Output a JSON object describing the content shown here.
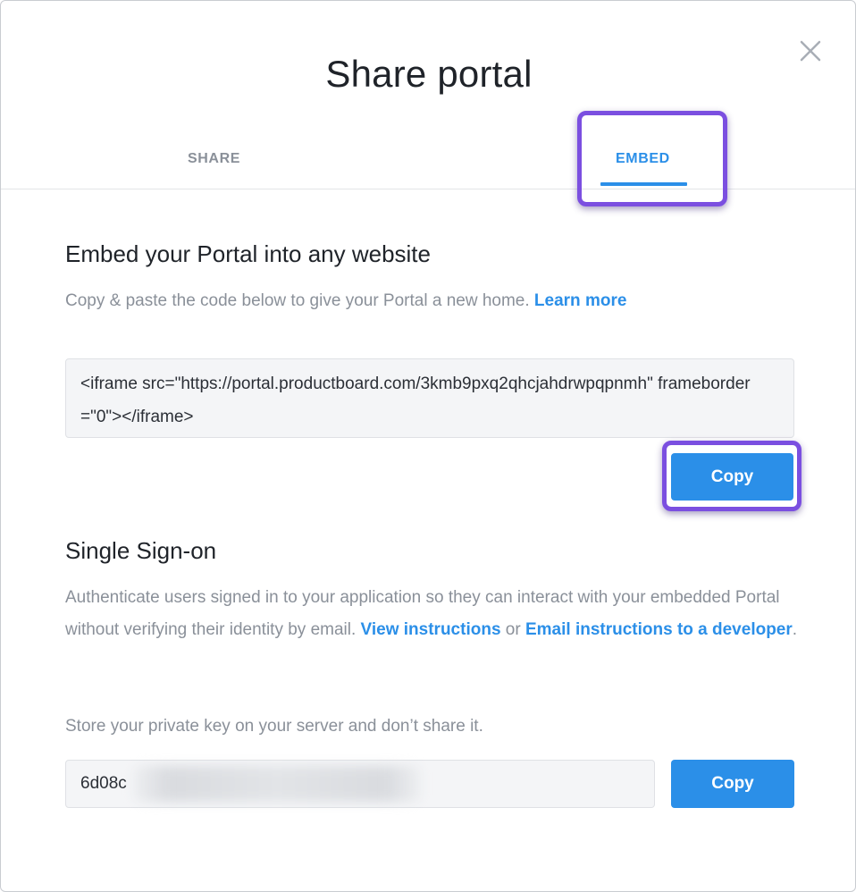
{
  "modal": {
    "title": "Share portal",
    "close_icon": "close-icon"
  },
  "tabs": [
    {
      "label": "SHARE",
      "active": false
    },
    {
      "label": "EMBED",
      "active": true
    }
  ],
  "embed": {
    "title": "Embed your Portal into any website",
    "description": "Copy & paste the code below to give your Portal a new home.",
    "learn_more": "Learn more",
    "code": "<iframe src=\"https://portal.productboard.com/3kmb9pxq2qhcjahdrwpqpnmh\" frameborder=\"0\"></iframe>",
    "copy_label": "Copy"
  },
  "sso": {
    "title": "Single Sign-on",
    "description_start": "Authenticate users signed in to your application so they can interact with your embedded Portal without verifying their identity by email. ",
    "view_instructions": "View instructions",
    "or_text": " or ",
    "email_instructions": "Email instructions to a developer",
    "period": ".",
    "store_note": "Store your private key on your server and don’t share it.",
    "key_prefix": "6d08c",
    "copy_label": "Copy"
  },
  "colors": {
    "accent": "#2b8fe8",
    "highlight": "#7b4fe0",
    "muted_text": "#8a9099",
    "input_bg": "#f4f5f7"
  }
}
